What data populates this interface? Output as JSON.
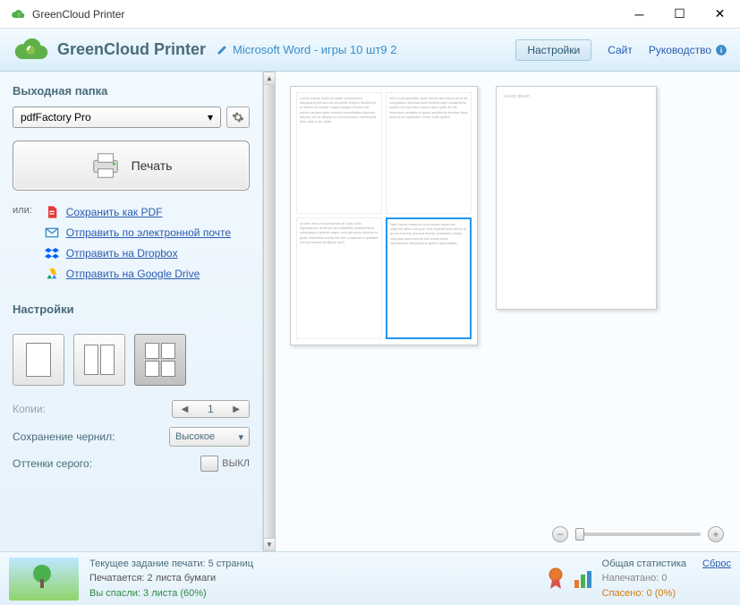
{
  "window": {
    "title": "GreenCloud Printer"
  },
  "header": {
    "app_name": "GreenCloud Printer",
    "doc_title": "Microsoft Word - игры 10 шт9 2",
    "settings_btn": "Настройки",
    "site_link": "Сайт",
    "guide_link": "Руководство"
  },
  "sidebar": {
    "output_folder_h": "Выходная папка",
    "printer_selected": "pdfFactory Pro",
    "print_btn": "Печать",
    "or_label": "или:",
    "links": {
      "pdf": "Сохранить как PDF",
      "email": "Отправить по электронной почте",
      "dropbox": "Отправить на Dropbox",
      "gdrive": "Отправить на Google Drive"
    },
    "settings_h": "Настройки",
    "copies_label": "Копии:",
    "copies_value": "1",
    "ink_label": "Сохранение чернил:",
    "ink_value": "Высокое",
    "gray_label": "Оттенки серого:",
    "gray_toggle": "ВЫКЛ"
  },
  "status": {
    "job_label": "Текущее задание печати: 5 страниц",
    "printing": "Печатается: 2 листа бумаги",
    "saved": "Вы спасли: 3 листа (60%)",
    "stats_h": "Общая статистика",
    "reset": "Сброс",
    "printed": "Напечатано: 0",
    "spared": "Спасено: 0 (0%)"
  }
}
